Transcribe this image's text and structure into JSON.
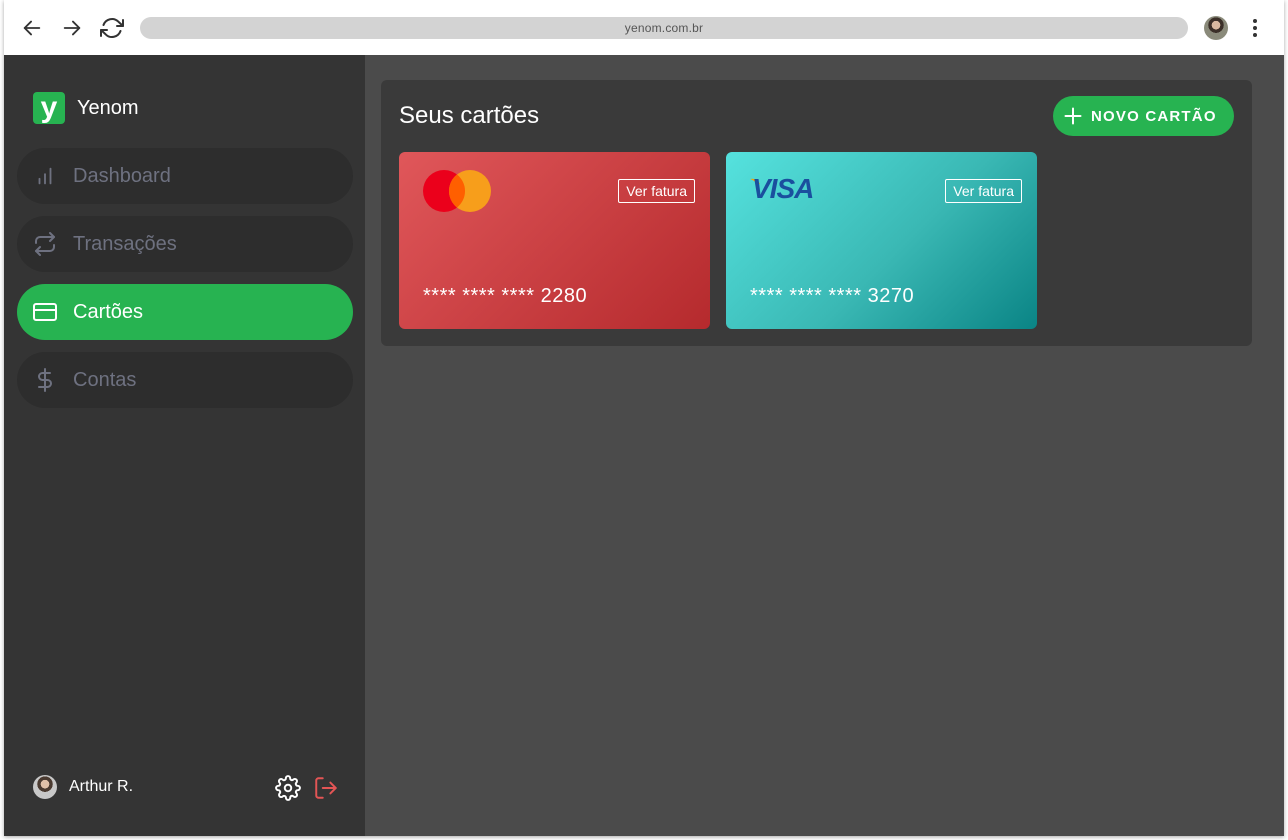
{
  "browser": {
    "url": "yenom.com.br"
  },
  "brand": {
    "logo_letter": "y",
    "name": "Yenom"
  },
  "sidebar": {
    "items": [
      {
        "label": "Dashboard",
        "icon": "bar-chart-icon",
        "active": false
      },
      {
        "label": "Transações",
        "icon": "repeat-icon",
        "active": false
      },
      {
        "label": "Cartões",
        "icon": "credit-card-icon",
        "active": true
      },
      {
        "label": "Contas",
        "icon": "dollar-icon",
        "active": false
      }
    ],
    "user": {
      "name": "Arthur R."
    }
  },
  "main": {
    "title": "Seus cartões",
    "new_card_label": "NOVO CARTÃO",
    "cards": [
      {
        "brand": "mastercard",
        "number": "**** **** **** 2280",
        "invoice_label": "Ver fatura"
      },
      {
        "brand": "visa",
        "brand_text": "VISA",
        "number": "**** **** **** 3270",
        "invoice_label": "Ver fatura"
      }
    ]
  },
  "colors": {
    "accent": "#27b351",
    "sidebar_bg": "#343434",
    "content_bg": "#4b4b4b",
    "panel_bg": "#3a3a3a"
  }
}
